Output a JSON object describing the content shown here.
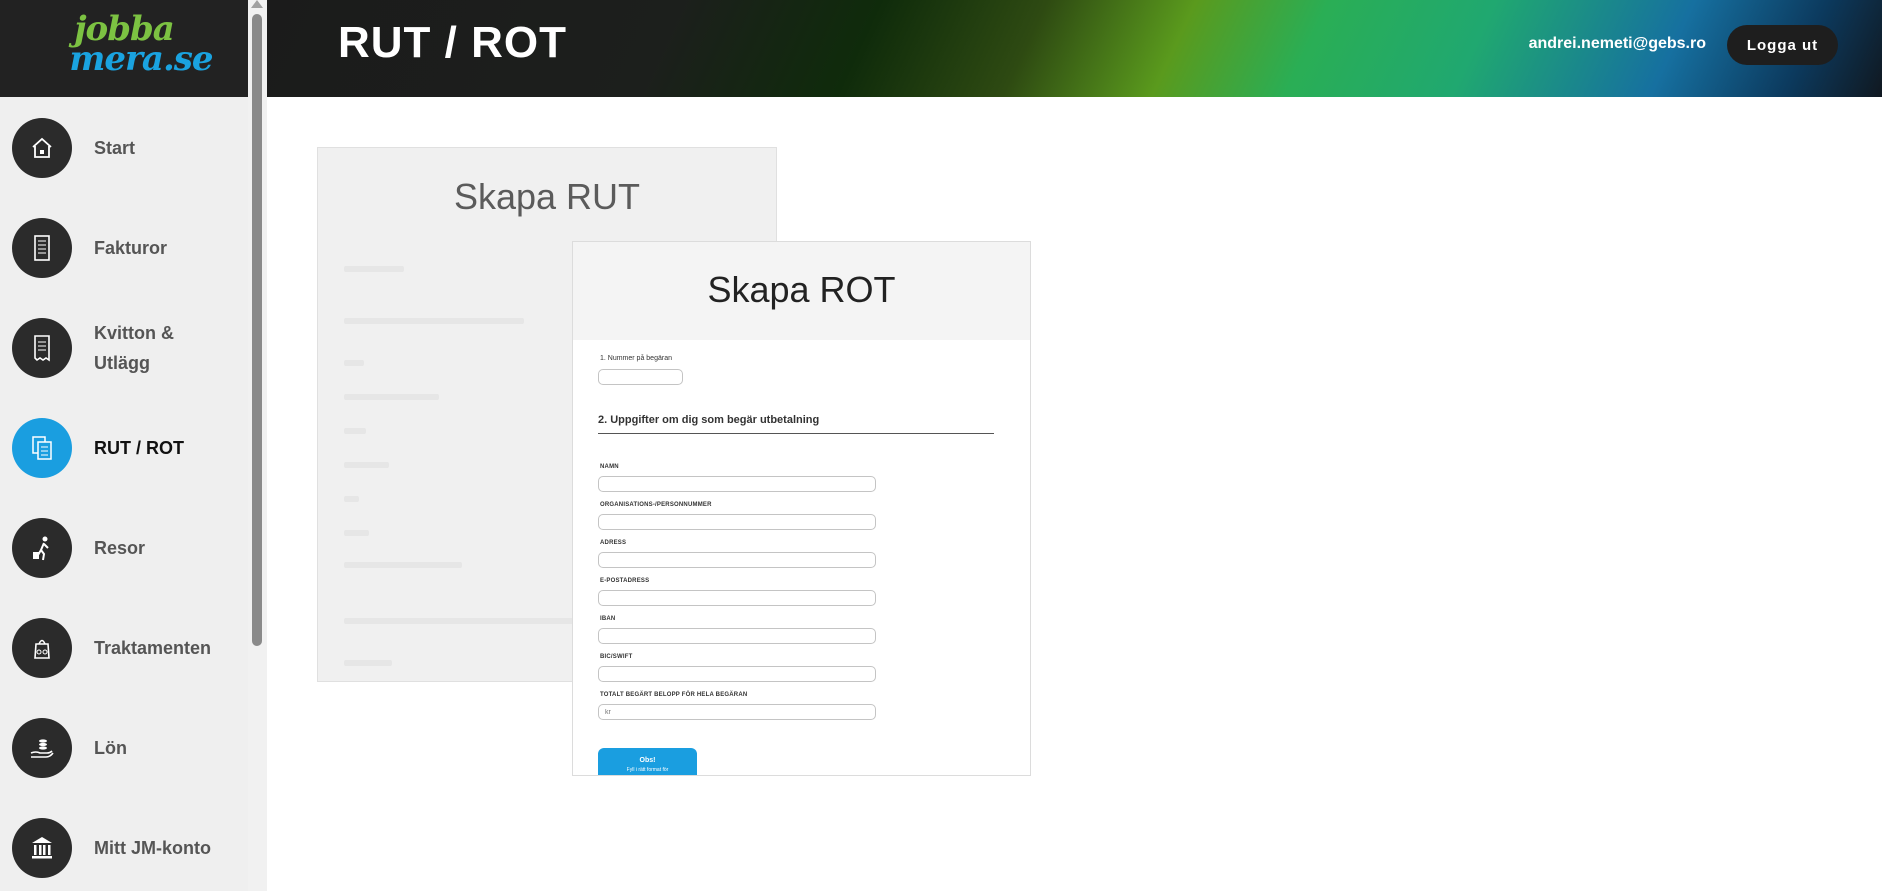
{
  "logo": {
    "line1": "jobba",
    "line2": "mera.se"
  },
  "header": {
    "title": "RUT / ROT",
    "user_email": "andrei.nemeti@gebs.ro",
    "logout_label": "Logga ut"
  },
  "sidebar": {
    "items": [
      {
        "label": "Start",
        "icon": "house-icon"
      },
      {
        "label": "Fakturor",
        "icon": "invoice-icon"
      },
      {
        "label": "Kvitton & Utlägg",
        "icon": "receipt-icon"
      },
      {
        "label": "RUT / ROT",
        "icon": "documents-icon",
        "active": true
      },
      {
        "label": "Resor",
        "icon": "traveler-icon"
      },
      {
        "label": "Traktamenten",
        "icon": "food-bag-icon"
      },
      {
        "label": "Lön",
        "icon": "hand-coins-icon"
      },
      {
        "label": "Mitt JM-konto",
        "icon": "bank-icon"
      }
    ]
  },
  "rut_card": {
    "title": "Skapa RUT"
  },
  "rot_card": {
    "title": "Skapa ROT",
    "request_number_label": "1. Nummer på begäran",
    "section2_title": "2. Uppgifter om dig som begär utbetalning",
    "fields": [
      {
        "label": "NAMN",
        "placeholder": ""
      },
      {
        "label": "ORGANISATIONS-/PERSONNUMMER",
        "placeholder": ""
      },
      {
        "label": "ADRESS",
        "placeholder": ""
      },
      {
        "label": "E-POSTADRESS",
        "placeholder": ""
      },
      {
        "label": "IBAN",
        "placeholder": ""
      },
      {
        "label": "BIC/SWIFT",
        "placeholder": ""
      },
      {
        "label": "TOTALT BEGÄRT BELOPP FÖR HELA BEGÄRAN",
        "placeholder": "kr"
      }
    ],
    "info_button": {
      "title": "Obs!",
      "text": "Fyll i rätt format för"
    }
  },
  "colors": {
    "accent": "#1a9ee0",
    "sidebar_bg": "#efefef",
    "dark": "#222222"
  }
}
